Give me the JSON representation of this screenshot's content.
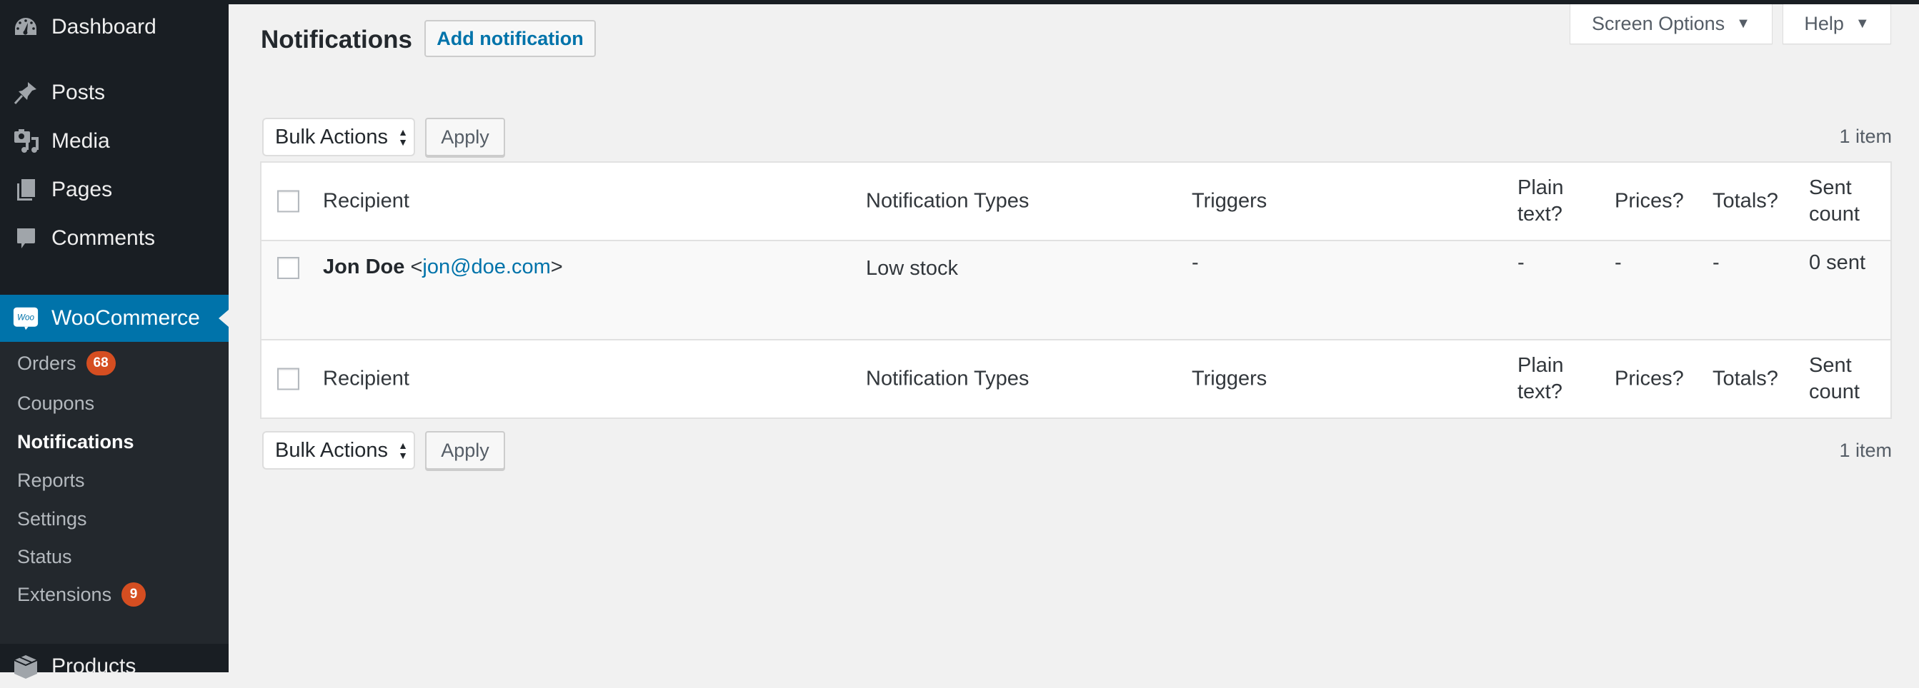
{
  "sidebar": {
    "items": [
      {
        "label": "Dashboard",
        "icon": "dashboard-icon"
      },
      {
        "label": "Posts",
        "icon": "pushpin-icon"
      },
      {
        "label": "Media",
        "icon": "media-icon"
      },
      {
        "label": "Pages",
        "icon": "pages-icon"
      },
      {
        "label": "Comments",
        "icon": "comment-icon"
      },
      {
        "label": "WooCommerce",
        "icon": "woocommerce-icon",
        "icon_text": "Woo"
      },
      {
        "label": "Products",
        "icon": "products-box-icon"
      }
    ],
    "submenu": [
      {
        "label": "Orders",
        "badge": "68"
      },
      {
        "label": "Coupons"
      },
      {
        "label": "Notifications",
        "current": true
      },
      {
        "label": "Reports"
      },
      {
        "label": "Settings"
      },
      {
        "label": "Status"
      },
      {
        "label": "Extensions",
        "badge": "9"
      }
    ]
  },
  "header": {
    "title": "Notifications",
    "add_button": "Add notification",
    "screen_options": "Screen Options",
    "help": "Help",
    "dropdown_glyph": "▼"
  },
  "tablenav": {
    "bulk_actions": "Bulk Actions",
    "apply": "Apply",
    "count": "1 item"
  },
  "table": {
    "columns": [
      "Recipient",
      "Notification Types",
      "Triggers",
      "Plain text?",
      "Prices?",
      "Totals?",
      "Sent count"
    ],
    "rows": [
      {
        "recipient_name": "Jon Doe",
        "recipient_email": "jon@doe.com",
        "notification_types": "Low stock",
        "triggers": "-",
        "plain_text": "-",
        "prices": "-",
        "totals": "-",
        "sent_count": "0 sent"
      }
    ]
  },
  "colors": {
    "sidebar_bg": "#191e23",
    "submenu_bg": "#23282d",
    "accent": "#0073aa",
    "badge": "#d54e21",
    "page_bg": "#f1f1f1"
  }
}
